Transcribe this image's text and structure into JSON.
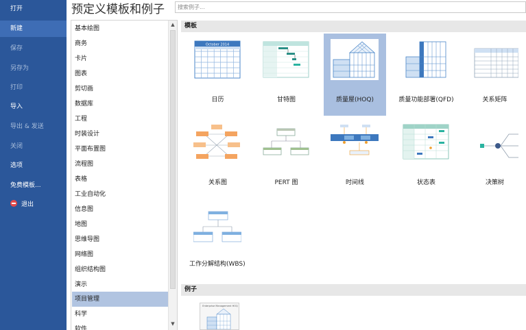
{
  "nav": {
    "items": [
      {
        "label": "打开",
        "state": "normal"
      },
      {
        "label": "新建",
        "state": "active"
      },
      {
        "label": "保存",
        "state": "dim"
      },
      {
        "label": "另存为",
        "state": "dim"
      },
      {
        "label": "打印",
        "state": "dim"
      },
      {
        "label": "导入",
        "state": "normal"
      },
      {
        "label": "导出 & 发送",
        "state": "dim"
      },
      {
        "label": "关闭",
        "state": "dim"
      },
      {
        "label": "选项",
        "state": "normal"
      },
      {
        "label": "免费模板...",
        "state": "normal"
      }
    ],
    "exit_label": "退出"
  },
  "header": {
    "title": "预定义模板和例子",
    "search_placeholder": "搜索例子..."
  },
  "categories": {
    "items": [
      "基本绘图",
      "商务",
      "卡片",
      "图表",
      "剪切画",
      "数据库",
      "工程",
      "时装设计",
      "平面布置图",
      "流程图",
      "表格",
      "工业自动化",
      "信息图",
      "地图",
      "思维导图",
      "网络图",
      "组织结构图",
      "演示",
      "项目管理",
      "科学",
      "软件"
    ],
    "selected": "项目管理"
  },
  "templates": {
    "section_label": "模板",
    "items": [
      {
        "label": "日历",
        "icon": "calendar-thumbnail-icon"
      },
      {
        "label": "甘特图",
        "icon": "gantt-thumbnail-icon"
      },
      {
        "label": "质量屋(HOQ)",
        "icon": "house-of-quality-thumbnail-icon"
      },
      {
        "label": "质量功能部署(QFD)",
        "icon": "qfd-thumbnail-icon"
      },
      {
        "label": "关系矩阵",
        "icon": "relation-matrix-thumbnail-icon"
      },
      {
        "label": "关系图",
        "icon": "relation-diagram-thumbnail-icon"
      },
      {
        "label": "PERT 图",
        "icon": "pert-thumbnail-icon"
      },
      {
        "label": "时间线",
        "icon": "timeline-thumbnail-icon"
      },
      {
        "label": "状态表",
        "icon": "status-table-thumbnail-icon"
      },
      {
        "label": "决策树",
        "icon": "decision-tree-thumbnail-icon"
      },
      {
        "label": "工作分解结构(WBS)",
        "icon": "wbs-thumbnail-icon"
      }
    ],
    "selected": "质量屋(HOQ)",
    "calendar_month": "October 2014"
  },
  "examples": {
    "section_label": "例子",
    "first_thumb_title": "Enterprise Management HOQ"
  },
  "colors": {
    "nav_bg": "#2b579a",
    "nav_active": "#3e6db5",
    "selection": "#a9bfe0",
    "accent_blue": "#4a86c8",
    "accent_orange": "#f4a460",
    "accent_teal": "#2ab3a0"
  }
}
